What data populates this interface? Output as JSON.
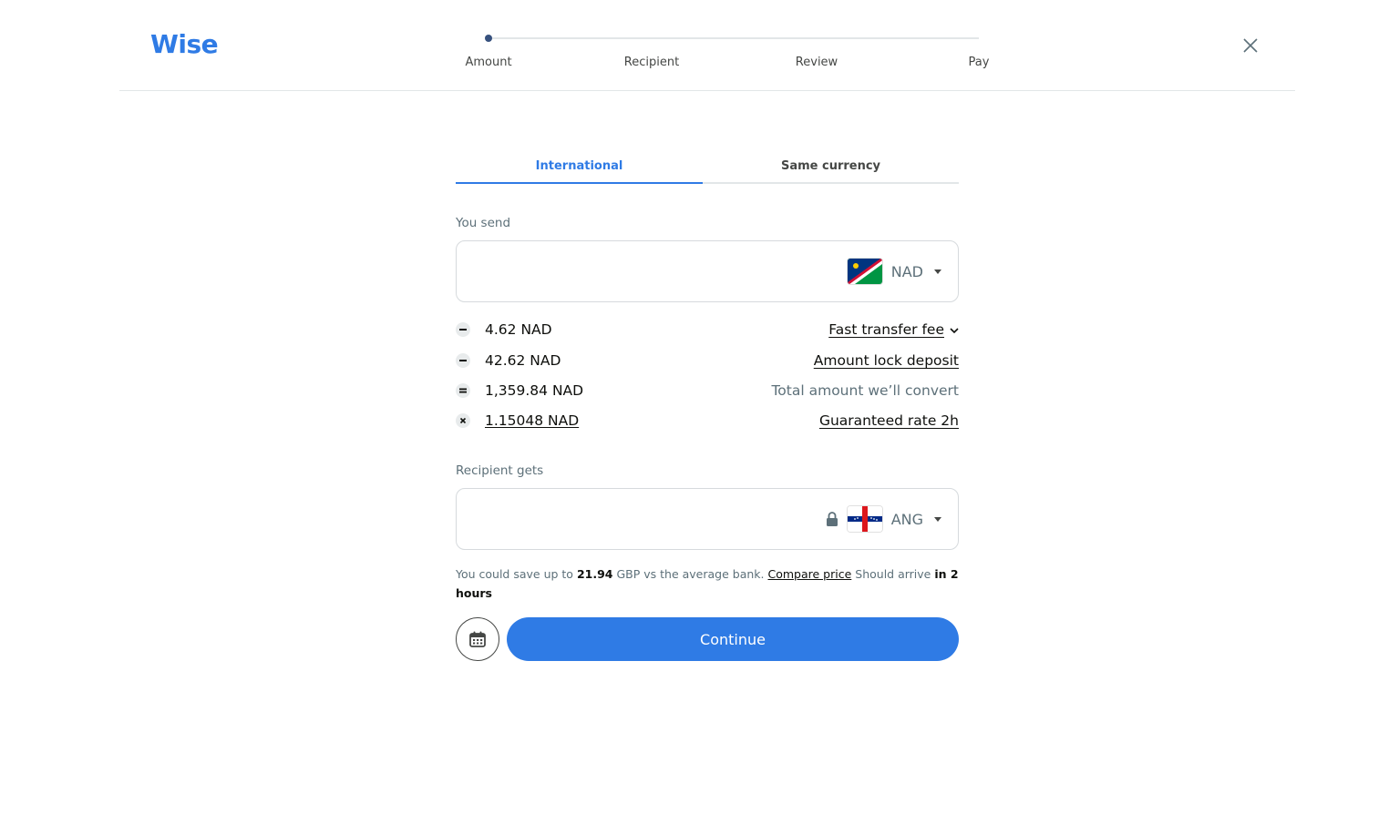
{
  "header": {
    "logo": "Wise",
    "steps": [
      "Amount",
      "Recipient",
      "Review",
      "Pay"
    ],
    "current_step": 1
  },
  "tabs": {
    "international": "International",
    "same_currency": "Same currency",
    "active": "International"
  },
  "send": {
    "label": "You send",
    "value": "",
    "currency": "NAD"
  },
  "fees": [
    {
      "icon": "minus-icon",
      "value": "4.62 NAD",
      "label": "Fast transfer fee"
    },
    {
      "icon": "minus-icon",
      "value": "42.62 NAD",
      "label": "Amount lock deposit"
    },
    {
      "icon": "equals-icon",
      "value": "1,359.84 NAD",
      "label": "Total amount we’ll convert"
    },
    {
      "icon": "multiply-icon",
      "value": "1.15048 NAD",
      "label": "Guaranteed rate 2h"
    }
  ],
  "receive": {
    "label": "Recipient gets",
    "value": "",
    "currency": "ANG"
  },
  "savings": {
    "prefix": "You could save up to",
    "amount": "21.94",
    "suffix": "GBP vs the average bank.",
    "compare_link": "Compare price",
    "arrive_prefix": "Should arrive",
    "arrive_time": "in 2 hours"
  },
  "actions": {
    "continue": "Continue"
  },
  "colors": {
    "brand": "#2f7be5",
    "text": "#0e0f0c",
    "muted": "#5d7079",
    "border": "#d6dadd"
  }
}
